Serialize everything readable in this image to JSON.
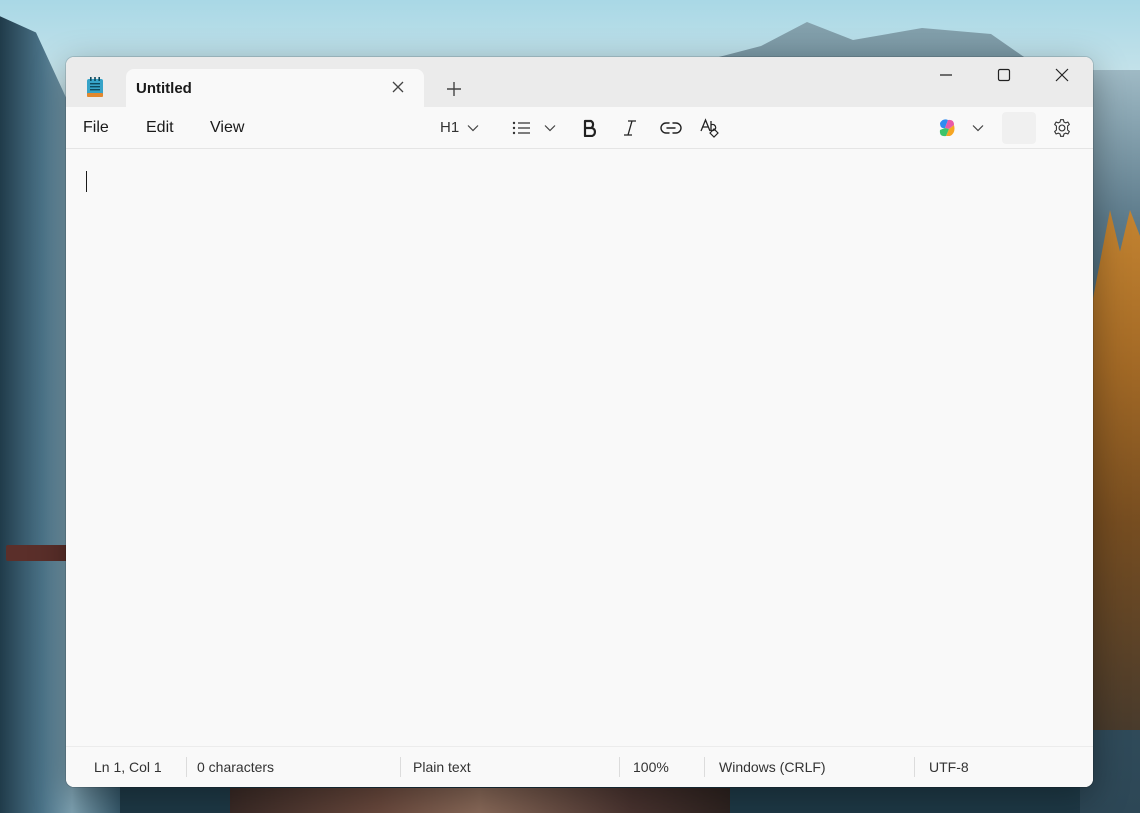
{
  "window": {
    "tab_title": "Untitled",
    "app_icon": "notepad-icon"
  },
  "menu": {
    "file": "File",
    "edit": "Edit",
    "view": "View"
  },
  "toolbar": {
    "heading_label": "H1",
    "icons": {
      "list": "bulleted-list-icon",
      "bold": "bold-icon",
      "italic": "italic-icon",
      "link": "link-icon",
      "spell": "spellcheck-icon",
      "copilot": "copilot-icon",
      "settings": "gear-icon"
    }
  },
  "editor": {
    "content": ""
  },
  "status": {
    "position": "Ln 1, Col 1",
    "characters": "0 characters",
    "format": "Plain text",
    "zoom": "100%",
    "line_endings": "Windows (CRLF)",
    "encoding": "UTF-8"
  },
  "colors": {
    "titlebar": "#ebebeb",
    "editor_bg": "#f9f9f9",
    "text": "#1a1a1a"
  }
}
